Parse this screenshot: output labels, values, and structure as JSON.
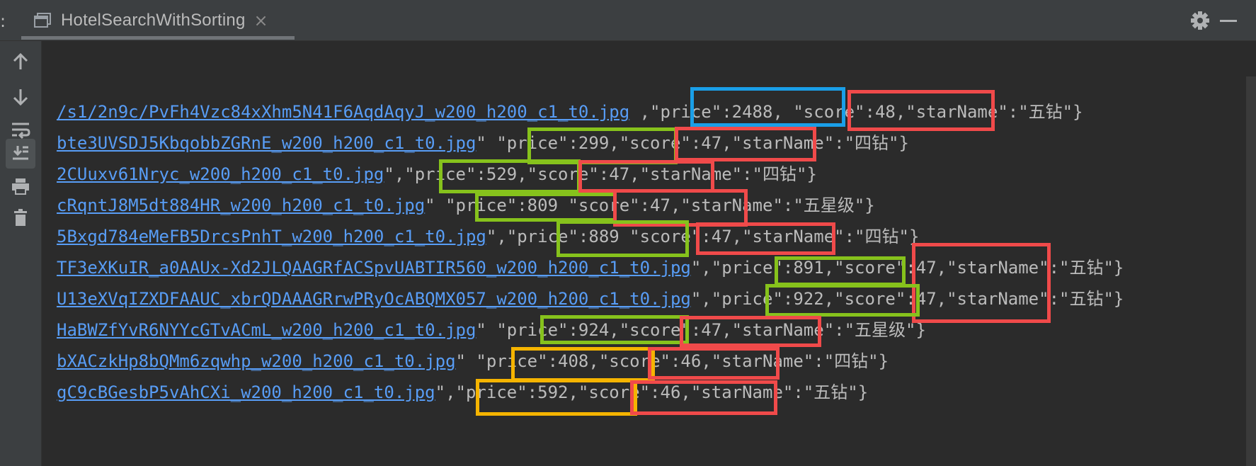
{
  "window": {
    "menu_dots": ":",
    "tab_title": "HotelSearchWithSorting",
    "tab_close": "×"
  },
  "toolbar_icons": [
    "arrow-up-icon",
    "arrow-down-icon",
    "soft-wrap-icon",
    "scroll-to-end-icon",
    "print-icon",
    "trash-icon"
  ],
  "console": {
    "lines": [
      {
        "link": "/s1/2n9c/PvFh4Vzc84xXhm5N41F6AqdAqyJ_w200_h200_c1_t0.jpg",
        "rest": " ,\"price\":2488, \"score\":48,\"starName\":\"五钻\"}"
      },
      {
        "link": "bte3UVSDJ5KbqobbZGRnE_w200_h200_c1_t0.jpg",
        "rest": "\" \"price\":299,\"score\":47,\"starName\":\"四钻\"}"
      },
      {
        "link": "2CUuxv61Nryc_w200_h200_c1_t0.jpg",
        "rest": "\",\"price\":529,\"score\":47,\"starName\":\"四钻\"}"
      },
      {
        "link": "cRqntJ8M5dt884HR_w200_h200_c1_t0.jpg",
        "rest": "\" \"price\":809 \"score\":47,\"starName\":\"五星级\"}"
      },
      {
        "link": "5Bxgd784eMeFB5DrcsPnhT_w200_h200_c1_t0.jpg",
        "rest": "\",\"price\":889 \"score\":47,\"starName\":\"四钻\"}"
      },
      {
        "link": "TF3eXKuIR_a0AAUx-Xd2JLQAAGRfACSpvUABTIR560_w200_h200_c1_t0.jpg",
        "rest": "\",\"price\":891,\"score\":47,\"starName\":\"五钻\"}"
      },
      {
        "link": "U13eXVqIZXDFAAUC_xbrQDAAAGRrwPRyOcABQMX057_w200_h200_c1_t0.jpg",
        "rest": "\",\"price\":922,\"score\":47,\"starName\":\"五钻\"}"
      },
      {
        "link": "HaBWZfYvR6NYYcGTvACmL_w200_h200_c1_t0.jpg",
        "rest": "\" \"price\":924,\"score\":47,\"starName\":\"五星级\"}"
      },
      {
        "link": "bXACzkHp8bQMm6zqwhp_w200_h200_c1_t0.jpg",
        "rest": "\" \"price\":408,\"score\":46,\"starName\":\"四钻\"}"
      },
      {
        "link": "gC9cBGesbP5vAhCXi_w200_h200_c1_t0.jpg",
        "rest": "\",\"price\":592,\"score\":46,\"starName\":\"五钻\"}"
      }
    ]
  },
  "colors": {
    "highlight_blue": "#1a9fe8",
    "highlight_red": "#f04a4a",
    "highlight_green": "#86c21c",
    "highlight_yellow": "#f5b400"
  }
}
